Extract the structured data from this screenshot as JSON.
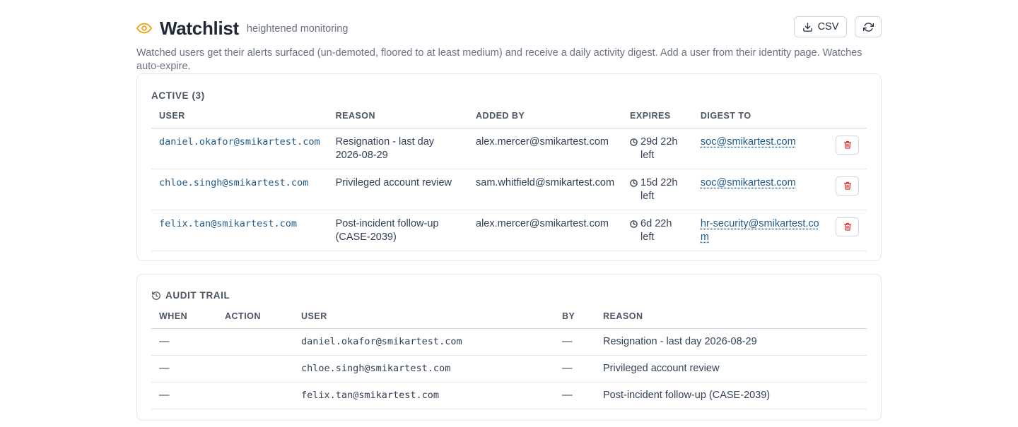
{
  "header": {
    "title": "Watchlist",
    "subtitle": "heightened monitoring",
    "csv_label": "CSV",
    "description": "Watched users get their alerts surfaced (un-demoted, floored to at least medium) and receive a daily activity digest. Add a user from their identity page. Watches auto-expire."
  },
  "colors": {
    "accent": "#e8a317",
    "link": "#1e5a8a",
    "danger": "#dc2626"
  },
  "active": {
    "title": "ACTIVE (3)",
    "columns": [
      "USER",
      "REASON",
      "ADDED BY",
      "EXPIRES",
      "DIGEST TO"
    ],
    "rows": [
      {
        "user": "daniel.okafor@smikartest.com",
        "reason": "Resignation - last day 2026-08-29",
        "added_by": "alex.mercer@smikartest.com",
        "expires": "29d 22h left",
        "digest_to": "soc@smikartest.com"
      },
      {
        "user": "chloe.singh@smikartest.com",
        "reason": "Privileged account review",
        "added_by": "sam.whitfield@smikartest.com",
        "expires": "15d 22h left",
        "digest_to": "soc@smikartest.com"
      },
      {
        "user": "felix.tan@smikartest.com",
        "reason": "Post-incident follow-up (CASE-2039)",
        "added_by": "alex.mercer@smikartest.com",
        "expires": "6d 22h left",
        "digest_to": "hr-security@smikartest.com"
      }
    ]
  },
  "audit": {
    "title": "AUDIT TRAIL",
    "columns": [
      "WHEN",
      "ACTION",
      "USER",
      "BY",
      "REASON"
    ],
    "rows": [
      {
        "when": "—",
        "action": "",
        "user": "daniel.okafor@smikartest.com",
        "by": "—",
        "reason": "Resignation - last day 2026-08-29"
      },
      {
        "when": "—",
        "action": "",
        "user": "chloe.singh@smikartest.com",
        "by": "—",
        "reason": "Privileged account review"
      },
      {
        "when": "—",
        "action": "",
        "user": "felix.tan@smikartest.com",
        "by": "—",
        "reason": "Post-incident follow-up (CASE-2039)"
      }
    ]
  }
}
